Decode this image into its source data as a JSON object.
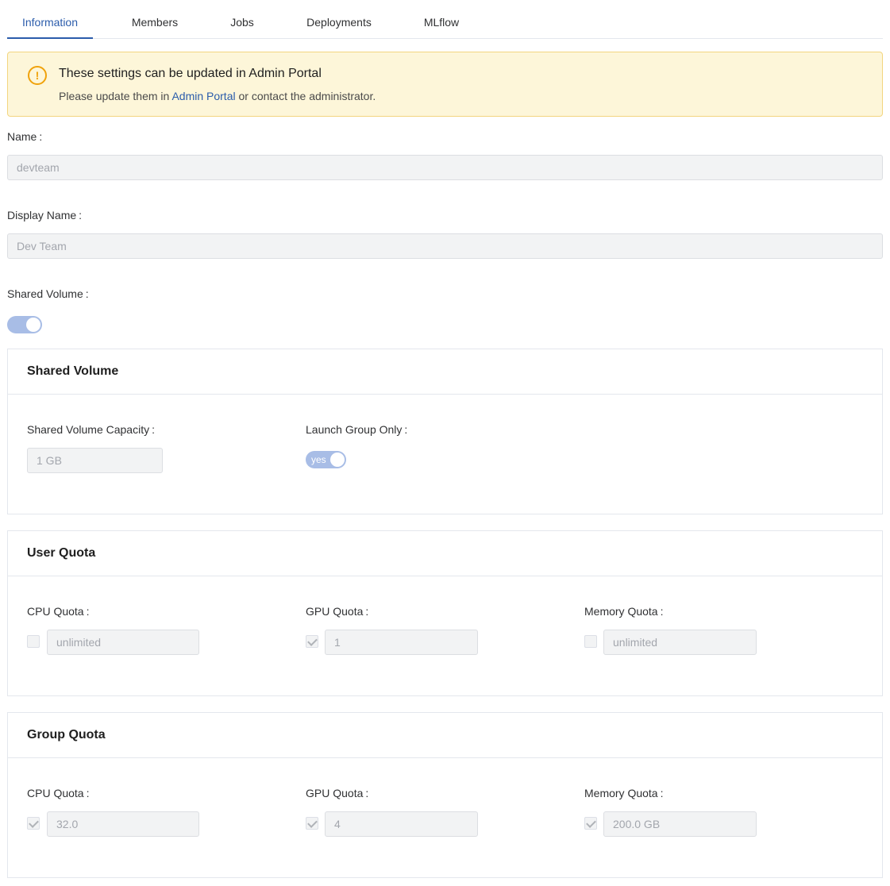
{
  "tabs": [
    {
      "label": "Information",
      "active": true
    },
    {
      "label": "Members",
      "active": false
    },
    {
      "label": "Jobs",
      "active": false
    },
    {
      "label": "Deployments",
      "active": false
    },
    {
      "label": "MLflow",
      "active": false
    }
  ],
  "alert": {
    "title": "These settings can be updated in Admin Portal",
    "desc_before": "Please update them in",
    "link": "Admin Portal",
    "desc_after": "or contact the administrator.",
    "icon": "exclamation-circle-icon"
  },
  "form": {
    "name_label": "Name",
    "name_value": "devteam",
    "display_name_label": "Display Name",
    "display_name_value": "Dev Team",
    "shared_volume_label": "Shared Volume",
    "shared_volume_enabled": true
  },
  "shared_volume": {
    "title": "Shared Volume",
    "capacity_label": "Shared Volume Capacity",
    "capacity_value": "1 GB",
    "launch_group_only_label": "Launch Group Only",
    "launch_group_only_text": "yes"
  },
  "user_quota": {
    "title": "User Quota",
    "cpu": {
      "label": "CPU Quota",
      "value": "unlimited",
      "checked": false
    },
    "gpu": {
      "label": "GPU Quota",
      "value": "1",
      "checked": true
    },
    "memory": {
      "label": "Memory Quota",
      "value": "unlimited",
      "checked": false
    }
  },
  "group_quota": {
    "title": "Group Quota",
    "cpu": {
      "label": "CPU Quota",
      "value": "32.0",
      "checked": true
    },
    "gpu": {
      "label": "GPU Quota",
      "value": "4",
      "checked": true
    },
    "memory": {
      "label": "Memory Quota",
      "value": "200.0 GB",
      "checked": true
    }
  },
  "label_suffix": ":",
  "colors": {
    "accent": "#2b5cab",
    "warning": "#f0a20b",
    "toggle_on": "#a8bde6"
  }
}
